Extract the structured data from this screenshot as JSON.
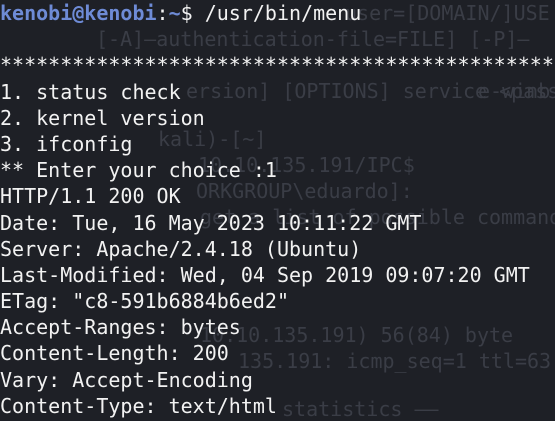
{
  "prompt": {
    "user_host": "kenobi@kenobi",
    "separator": ":",
    "path": "~",
    "symbol": "$",
    "command": " /usr/bin/menu"
  },
  "output_lines": [
    "",
    "***********************************************",
    "1. status check",
    "2. kernel version",
    "3. ifconfig",
    "** Enter your choice :1",
    "HTTP/1.1 200 OK",
    "Date: Tue, 16 May 2023 10:11:22 GMT",
    "Server: Apache/2.4.18 (Ubuntu)",
    "Last-Modified: Wed, 04 Sep 2019 09:07:20 GMT",
    "ETag: \"c8-591b6884b6ed2\"",
    "Accept-Ranges: bytes",
    "Content-Length: 200",
    "Vary: Accept-Encoding",
    "Content-Type: text/html"
  ],
  "background_ghost_text": [
    "user=[DOMAIN/]USE",
    "[-A]—authentication-file=FILE] [-P]—",
    "e-winb",
    "ersion] [OPTIONS] service <passw",
    "kali)-[~]",
    "10.10.135.191/IPC$",
    "ORKGROUP\\eduardo]:",
    "get a list of possible commands.",
    "10.10.135.191) 56(84) byte",
    "135.191: icmp_seq=1 ttl=63",
    "statistics ——"
  ],
  "colors": {
    "background": "#1e2026",
    "text": "#f2f2f2",
    "prompt": "#6e8bd6",
    "ghost": "#3a3d46"
  }
}
